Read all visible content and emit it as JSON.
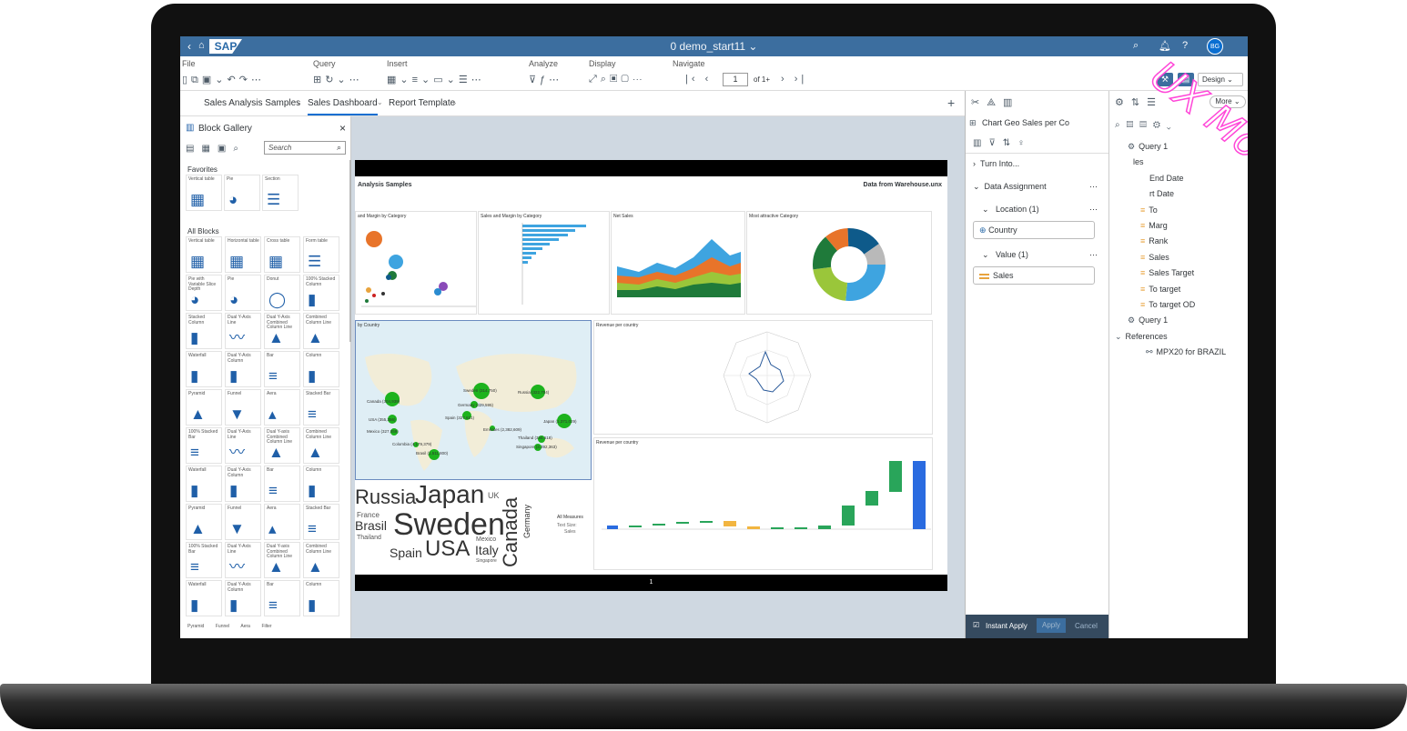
{
  "app": {
    "title": "0 demo_start11",
    "brand": "SAP",
    "avatar": "BG"
  },
  "menu": {
    "groups": [
      "File",
      "Query",
      "Insert",
      "Analyze",
      "Display",
      "Navigate"
    ],
    "page_value": "1",
    "page_of": "of 1+",
    "mode": "Design"
  },
  "tabs": [
    "Sales Analysis Samples",
    "Sales Dashboard",
    "Report Template"
  ],
  "gallery": {
    "title": "Block Gallery",
    "search_placeholder": "Search",
    "favorites_label": "Favorites",
    "favorites": [
      {
        "label": "Vertical table",
        "icon": "▦"
      },
      {
        "label": "Pie",
        "icon": "◕"
      },
      {
        "label": "Section",
        "icon": "☰"
      }
    ],
    "all_label": "All Blocks",
    "blocks": [
      {
        "label": "Vertical table",
        "icon": "▦"
      },
      {
        "label": "Horizontal table",
        "icon": "▦"
      },
      {
        "label": "Cross table",
        "icon": "▦"
      },
      {
        "label": "Form table",
        "icon": "☰"
      },
      {
        "label": "Pie with Variable Slice Depth",
        "icon": "◕"
      },
      {
        "label": "Pie",
        "icon": "◕"
      },
      {
        "label": "Donut",
        "icon": "◯"
      },
      {
        "label": "100% Stacked Column",
        "icon": "▮"
      },
      {
        "label": "Stacked Column",
        "icon": "▮"
      },
      {
        "label": "Dual Y-Axis Line",
        "icon": "〰"
      },
      {
        "label": "Dual Y-Axis Combined Column Line",
        "icon": "▲"
      },
      {
        "label": "Combined Column Line",
        "icon": "▲"
      },
      {
        "label": "Waterfall",
        "icon": "▮"
      },
      {
        "label": "Dual Y-Axis Column",
        "icon": "▮"
      },
      {
        "label": "Bar",
        "icon": "≡"
      },
      {
        "label": "Column",
        "icon": "▮"
      },
      {
        "label": "Pyramid",
        "icon": "▲"
      },
      {
        "label": "Funnel",
        "icon": "▼"
      },
      {
        "label": "Aera",
        "icon": "▴"
      },
      {
        "label": "Stacked Bar",
        "icon": "≡"
      },
      {
        "label": "100% Stacked Bar",
        "icon": "≡"
      },
      {
        "label": "Dual Y-Axis Line",
        "icon": "〰"
      },
      {
        "label": "Dual Y-axis Combined Column Line",
        "icon": "▲"
      },
      {
        "label": "Combined Column Line",
        "icon": "▲"
      },
      {
        "label": "Waterfall",
        "icon": "▮"
      },
      {
        "label": "Dual Y-Axis Column",
        "icon": "▮"
      },
      {
        "label": "Bar",
        "icon": "≡"
      },
      {
        "label": "Column",
        "icon": "▮"
      },
      {
        "label": "Pyramid",
        "icon": "▲"
      },
      {
        "label": "Funnel",
        "icon": "▼"
      },
      {
        "label": "Aera",
        "icon": "▴"
      },
      {
        "label": "Stacked Bar",
        "icon": "≡"
      },
      {
        "label": "100% Stacked Bar",
        "icon": "≡"
      },
      {
        "label": "Dual Y-Axis Line",
        "icon": "〰"
      },
      {
        "label": "Dual Y-axis Combined Column Line",
        "icon": "▲"
      },
      {
        "label": "Combined Column Line",
        "icon": "▲"
      },
      {
        "label": "Waterfall",
        "icon": "▮"
      },
      {
        "label": "Dual Y-Axis Column",
        "icon": "▮"
      },
      {
        "label": "Bar",
        "icon": "≡"
      },
      {
        "label": "Column",
        "icon": "▮"
      }
    ],
    "footer": [
      "Pyramid",
      "Funnel",
      "Aera",
      "Filter"
    ]
  },
  "report": {
    "header_left": "Analysis Samples",
    "header_right": "Data from Warehouse.unx",
    "panels": {
      "p1": "and Margin by Category",
      "p2": "Sales and Margin by Category",
      "p3": "Net Sales",
      "p4": "Most attractive Category",
      "map": "by Country",
      "radar": "Revenue per country",
      "waterfall": "Revenue per country"
    },
    "map_labels": [
      "Sweden (314,750)",
      "Russia (322,704)",
      "Canada (304,939)",
      "USA (355,356)",
      "Germany (329,595)",
      "Spain (327,621)",
      "Mexico (327,059)",
      "Emirates (2,382,609)",
      "Japan (1,371,029)",
      "Thailand (334,618)",
      "Colombia (4,179,379)",
      "Singapore (3,392,363)",
      "Brasil (1,511,800)"
    ],
    "words": {
      "russia": "Russia",
      "japan": "Japan",
      "uk": "UK",
      "canada": "Canada",
      "france": "France",
      "brasil": "Brasil",
      "sweden": "Sweden",
      "thailand": "Thailand",
      "germany": "Germany",
      "spain": "Spain",
      "usa": "USA",
      "mexico": "Mexico",
      "italy": "Italy",
      "singapore": "Singapore",
      "legend1": "All Measures",
      "legend2": "Text Size:",
      "legend3": "Sales"
    },
    "footer_page": "1"
  },
  "props": {
    "chart_name": "Chart Geo Sales per Co",
    "turn_into": "Turn Into...",
    "data_assignment": "Data Assignment",
    "location": "Location (1)",
    "country": "Country",
    "value": "Value (1)",
    "sales": "Sales",
    "instant_apply": "Instant Apply",
    "apply": "Apply",
    "cancel": "Cancel"
  },
  "outline": {
    "more": "More",
    "items": [
      "Query 1",
      "les",
      "End Date",
      "rt Date",
      "To",
      "Marg",
      "Rank",
      "Sales",
      "Sales Target",
      "To target",
      "To target OD",
      "Query 1",
      "References",
      "MPX20 for BRAZIL"
    ]
  },
  "watermark": "UX Mockup!",
  "colors": {
    "shell": "#3c6e9f",
    "accent": "#0a6ed1",
    "map_bubble": "#1db31d",
    "watermark": "#ff46d8"
  }
}
